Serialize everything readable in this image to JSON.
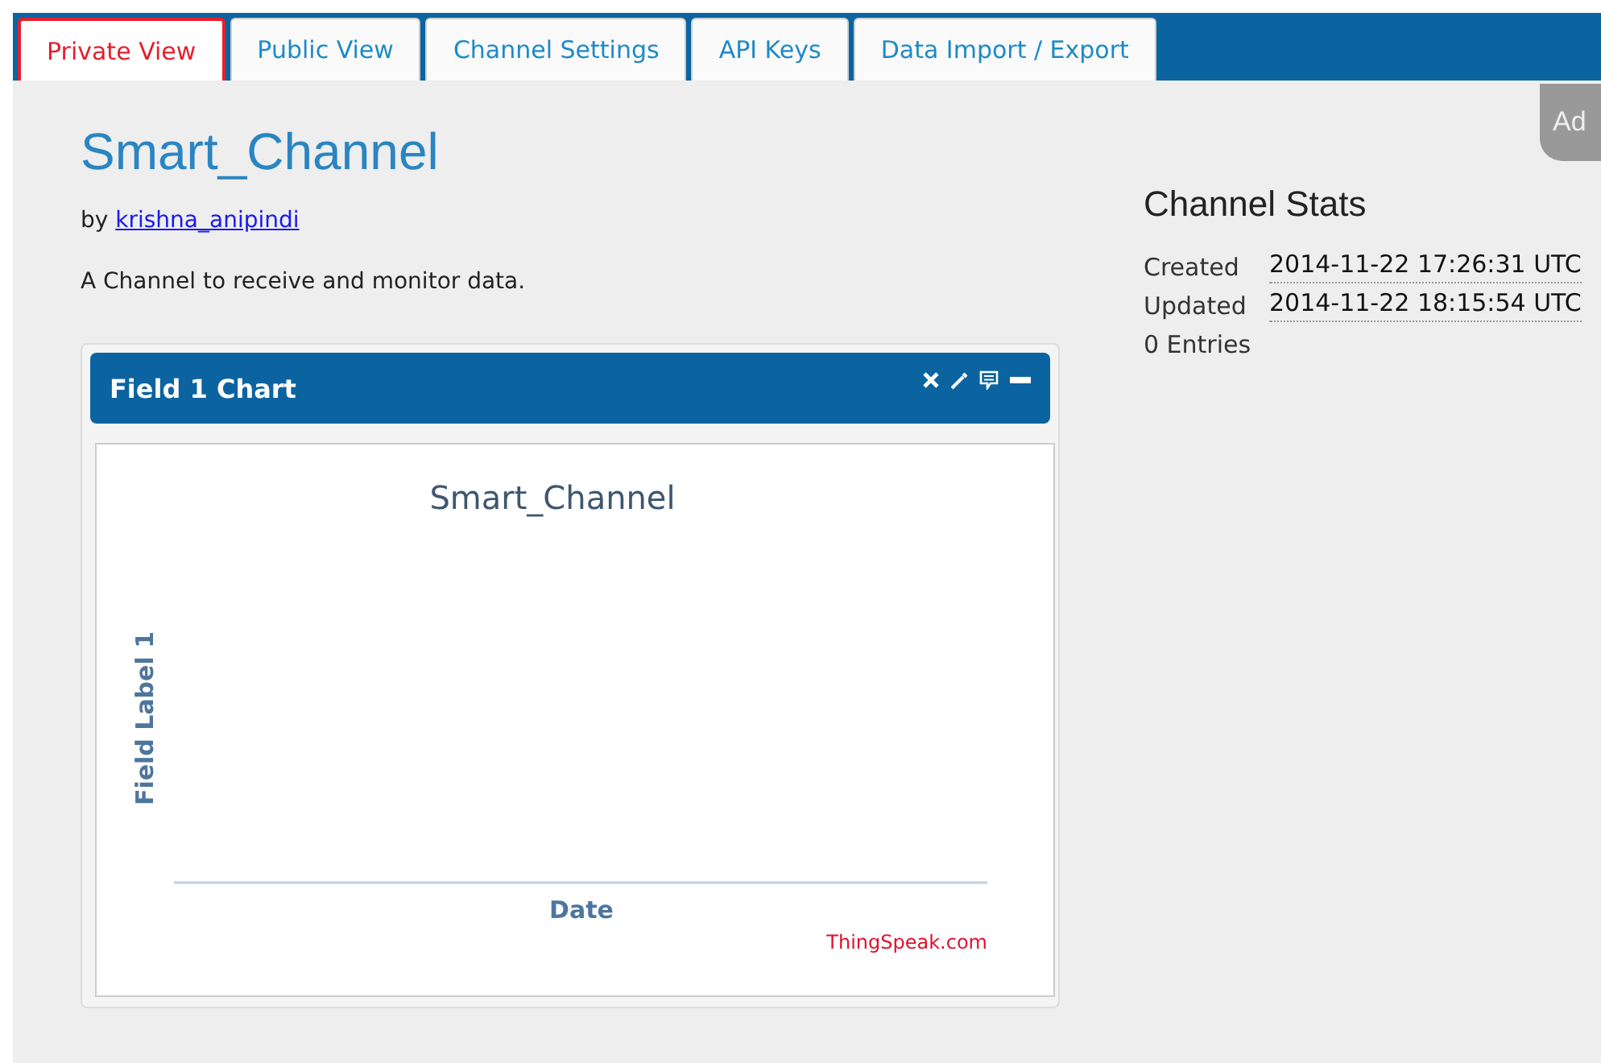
{
  "tabs": [
    {
      "label": "Private View",
      "selected": true
    },
    {
      "label": "Public View",
      "selected": false
    },
    {
      "label": "Channel Settings",
      "selected": false
    },
    {
      "label": "API Keys",
      "selected": false
    },
    {
      "label": "Data Import / Export",
      "selected": false
    }
  ],
  "side_tab": {
    "label": "Ad"
  },
  "channel": {
    "title": "Smart_Channel",
    "by": "by",
    "author": "krishna_anipindi",
    "description": "A Channel to receive and monitor data."
  },
  "chart_panel": {
    "title": "Field 1 Chart",
    "chart": {
      "title": "Smart_Channel",
      "ylabel": "Field Label 1",
      "xlabel": "Date",
      "credit": "ThingSpeak.com"
    }
  },
  "stats": {
    "title": "Channel Stats",
    "rows": [
      {
        "label": "Created",
        "value": "2014-11-22 17:26:31 UTC"
      },
      {
        "label": "Updated",
        "value": "2014-11-22 18:15:54 UTC"
      }
    ],
    "entries": "0 Entries"
  }
}
